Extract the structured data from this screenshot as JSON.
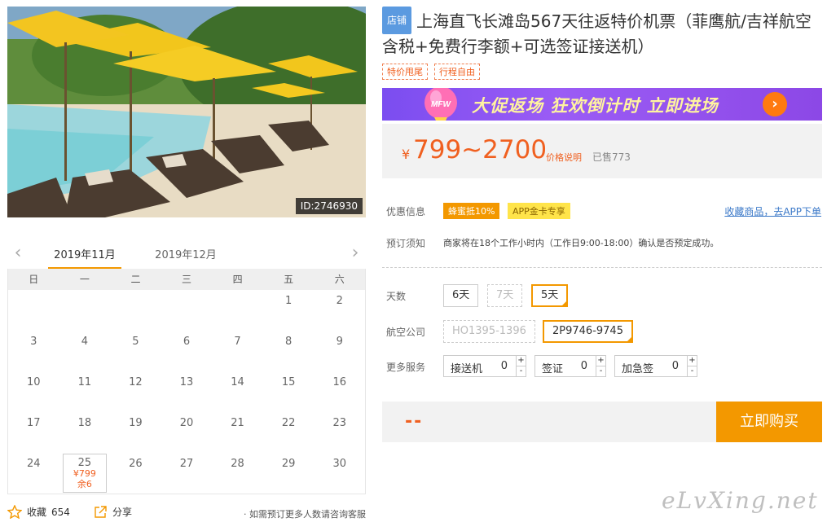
{
  "hero": {
    "id_tag": "ID:2746930"
  },
  "calendar": {
    "prev_arrow": "‹",
    "next_arrow": "›",
    "months": [
      "2019年11月",
      "2019年12月"
    ],
    "weekdays": [
      "日",
      "一",
      "二",
      "三",
      "四",
      "五",
      "六"
    ],
    "rows": [
      [
        "",
        "",
        "",
        "",
        "",
        "1",
        "2"
      ],
      [
        "3",
        "4",
        "5",
        "6",
        "7",
        "8",
        "9"
      ],
      [
        "10",
        "11",
        "12",
        "13",
        "14",
        "15",
        "16"
      ],
      [
        "17",
        "18",
        "19",
        "20",
        "21",
        "22",
        "23"
      ],
      [
        "24",
        "25",
        "26",
        "27",
        "28",
        "29",
        "30"
      ]
    ],
    "priced_day": {
      "day": "25",
      "price": "¥799",
      "remaining": "余6"
    }
  },
  "bottom": {
    "fav_label": "收藏",
    "fav_count": "654",
    "share_label": "分享",
    "note": "· 如需预订更多人数请咨询客服"
  },
  "product": {
    "shop_badge": "店铺",
    "title": "上海直飞长滩岛567天往返特价机票（菲鹰航/吉祥航空含税+免费行李额+可选签证接送机）",
    "tags": [
      "特价甩尾",
      "行程自由"
    ]
  },
  "banner": {
    "text": "大促返场 狂欢倒计时 立即进场",
    "balloon_text": "MFW",
    "go_symbol": "›"
  },
  "price": {
    "currency": "¥",
    "amount": "799~2700",
    "explain": "价格说明",
    "sold": "已售773"
  },
  "promo": {
    "label": "优惠信息",
    "badge1": "蜂蜜抵10%",
    "badge2": "APP金卡专享",
    "fav_link": "收藏商品，去APP下单"
  },
  "notice": {
    "label": "预订须知",
    "text": "商家将在18个工作小时内（工作日9:00-18:00）确认是否预定成功。"
  },
  "days": {
    "label": "天数",
    "options": [
      "6天",
      "7天",
      "5天"
    ]
  },
  "airline": {
    "label": "航空公司",
    "options": [
      "HO1395-1396",
      "2P9746-9745"
    ]
  },
  "services": {
    "label": "更多服务",
    "items": [
      {
        "name": "接送机",
        "value": "0"
      },
      {
        "name": "签证",
        "value": "0"
      },
      {
        "name": "加急签",
        "value": "0"
      }
    ],
    "plus": "+",
    "minus": "-"
  },
  "buy": {
    "total": "--",
    "button": "立即购买"
  },
  "watermark": "eLvXing.net",
  "colors": {
    "accent": "#f39800",
    "price": "#f06020",
    "link": "#3a78c8",
    "banner": "#8c48e6"
  }
}
